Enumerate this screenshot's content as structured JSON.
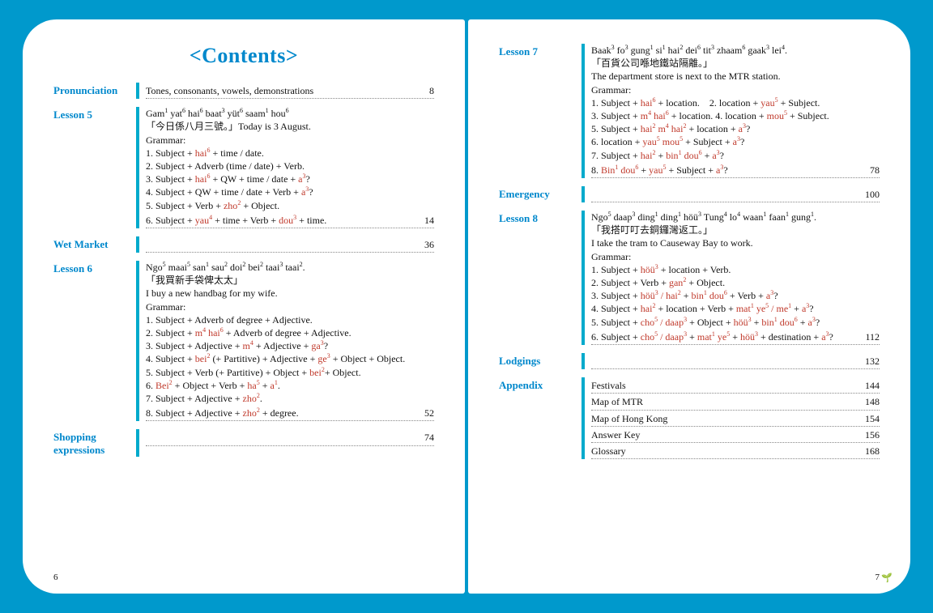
{
  "title": "<Contents>",
  "leftPageNum": "6",
  "rightPageNum": "7",
  "left": [
    {
      "label": "Pronunciation",
      "rows": [
        {
          "html": "Tones, consonants, vowels, demonstrations",
          "page": "8"
        }
      ]
    },
    {
      "label": "Lesson 5",
      "lines": [
        "Gam<sup>1</sup> yat<sup>6</sup> hai<sup>6</sup> baat<sup>3</sup> yüt<sup>6</sup> saam<sup>1</sup> hou<sup>6</sup>",
        "「今日係八月三號。」Today is 3 August.",
        "Grammar:",
        "1. Subject + <span class='hi'>hai<sup>6</sup></span> + time / date.",
        "2. Subject + Adverb (time / date) + Verb.",
        "3. Subject + <span class='hi'>hai<sup>6</sup></span> + QW + time / date + <span class='hi'>a<sup>3</sup></span>?",
        "4. Subject + QW + time / date + Verb + <span class='hi'>a<sup>3</sup></span>?",
        "5. Subject + Verb + <span class='hi'>zho<sup>2</sup></span> + Object."
      ],
      "lastRow": {
        "html": "6. Subject + <span class='hi'>yau<sup>4</sup></span> + time + Verb + <span class='hi'>dou<sup>3</sup></span> + time.",
        "page": "14"
      }
    },
    {
      "label": "Wet Market",
      "rows": [
        {
          "html": "",
          "page": "36"
        }
      ]
    },
    {
      "label": "Lesson 6",
      "lines": [
        "Ngo<sup>5</sup> maai<sup>5</sup> san<sup>1</sup> sau<sup>2</sup> doi<sup>2</sup> bei<sup>2</sup> taai<sup>3</sup> taai<sup>2</sup>.",
        "「我買新手袋俾太太」",
        "I buy a new handbag for my wife.",
        "Grammar:",
        "1. Subject + Adverb of degree + Adjective.",
        "2. Subject + <span class='hi'>m<sup>4</sup> hai<sup>6</sup></span> + Adverb of degree + Adjective.",
        "3. Subject + Adjective + <span class='hi'>m<sup>4</sup></span> + Adjective + <span class='hi'>ga<sup>3</sup></span>?",
        "4. Subject + <span class='hi'>bei<sup>2</sup></span> (+ Partitive) + Adjective + <span class='hi'>ge<sup>3</sup></span> + Object + Object.",
        "5. Subject + Verb (+ Partitive) + Object + <span class='hi'>bei<sup>2</sup></span>+ Object.",
        "6. <span class='hi'>Bei<sup>2</sup></span> + Object + Verb + <span class='hi'>ha<sup>5</sup></span> + <span class='hi'>a<sup>1</sup></span>.",
        "7. Subject + Adjective + <span class='hi'>zho<sup>2</sup></span>."
      ],
      "lastRow": {
        "html": "8. Subject + Adjective + <span class='hi'>zho<sup>2</sup></span> + degree.",
        "page": "52"
      }
    },
    {
      "label": "Shopping expressions",
      "rows": [
        {
          "html": "",
          "page": "74"
        }
      ]
    }
  ],
  "right": [
    {
      "label": "Lesson 7",
      "lines": [
        "Baak<sup>3</sup> fo<sup>3</sup> gung<sup>1</sup> si<sup>1</sup> hai<sup>2</sup> dei<sup>6</sup> tit<sup>3</sup> zhaam<sup>6</sup> gaak<sup>3</sup> lei<sup>4</sup>.",
        "「百貨公司喺地鐵站隔離。」",
        "The department store is next to the MTR station.",
        "Grammar:",
        "1. Subject + <span class='hi'>hai<sup>6</sup></span> + location.&nbsp;&nbsp;&nbsp;&nbsp;2. location + <span class='hi'>yau<sup>5</sup></span> + Subject.",
        "3. Subject + <span class='hi'>m<sup>4</sup> hai<sup>6</sup></span> + location. 4. location + <span class='hi'>mou<sup>5</sup></span> + Subject.",
        "5. Subject + <span class='hi'>hai<sup>2</sup> m<sup>4</sup> hai<sup>2</sup></span> + location + <span class='hi'>a<sup>3</sup></span>?",
        "6. location + <span class='hi'>yau<sup>5</sup> mou<sup>5</sup></span> + Subject + <span class='hi'>a<sup>3</sup></span>?",
        "7. Subject + <span class='hi'>hai<sup>2</sup></span> + <span class='hi'>bin<sup>1</sup> dou<sup>6</sup></span> + <span class='hi'>a<sup>3</sup></span>?"
      ],
      "lastRow": {
        "html": "8. <span class='hi'>Bin<sup>1</sup> dou<sup>6</sup></span> + <span class='hi'>yau<sup>5</sup></span> + Subject + <span class='hi'>a<sup>3</sup></span>?",
        "page": "78"
      }
    },
    {
      "label": "Emergency",
      "rows": [
        {
          "html": "",
          "page": "100"
        }
      ]
    },
    {
      "label": "Lesson 8",
      "lines": [
        "Ngo<sup>5</sup> daap<sup>3</sup> ding<sup>1</sup> ding<sup>1</sup> höü<sup>3</sup> Tung<sup>4</sup> lo<sup>4</sup> waan<sup>1</sup> faan<sup>1</sup> gung<sup>1</sup>.",
        "「我搭叮叮去銅鑼灣返工。」",
        "I take the tram to Causeway Bay to work.",
        "Grammar:",
        "1. Subject + <span class='hi'>höü<sup>3</sup></span> + location + Verb.",
        "2. Subject + Verb + <span class='hi'>gan<sup>2</sup></span> + Object.",
        "3. Subject + <span class='hi'>höü<sup>3</sup> / hai<sup>2</sup></span> + <span class='hi'>bin<sup>1</sup> dou<sup>6</sup></span> + Verb + <span class='hi'>a<sup>3</sup></span>?",
        "4. Subject + <span class='hi'>hai<sup>2</sup></span> + location + Verb + <span class='hi'>mat<sup>1</sup> ye<sup>5</sup> / me<sup>1</sup></span> + <span class='hi'>a<sup>3</sup></span>?",
        "5. Subject + <span class='hi'>cho<sup>5</sup> / daap<sup>3</sup></span> + Object + <span class='hi'>höü<sup>3</sup></span> + <span class='hi'>bin<sup>1</sup> dou<sup>6</sup></span> + <span class='hi'>a<sup>3</sup></span>?"
      ],
      "lastRow": {
        "html": "6. Subject + <span class='hi'>cho<sup>5</sup> / daap<sup>3</sup></span> + <span class='hi'>mat<sup>1</sup> ye<sup>5</sup></span> + <span class='hi'>höü<sup>3</sup></span> + destination + <span class='hi'>a<sup>3</sup></span>?",
        "page": "112"
      }
    },
    {
      "label": "Lodgings",
      "rows": [
        {
          "html": "",
          "page": "132"
        }
      ]
    },
    {
      "label": "Appendix",
      "rows": [
        {
          "html": "Festivals",
          "page": "144"
        },
        {
          "html": "Map of MTR",
          "page": "148"
        },
        {
          "html": "Map of Hong Kong",
          "page": "154"
        },
        {
          "html": "Answer Key",
          "page": "156"
        },
        {
          "html": "Glossary",
          "page": "168"
        }
      ]
    }
  ]
}
